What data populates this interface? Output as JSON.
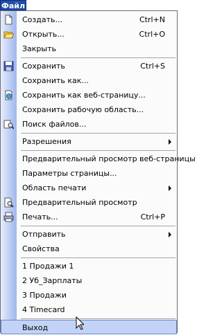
{
  "menubar": {
    "file_label": "Файл"
  },
  "menu": {
    "items": [
      {
        "label": "Создать...",
        "shortcut": "Ctrl+N",
        "icon": "new-document-icon"
      },
      {
        "label": "Открыть...",
        "shortcut": "Ctrl+O",
        "icon": "open-folder-icon"
      },
      {
        "label": "Закрыть",
        "shortcut": ""
      },
      {
        "label": "Сохранить",
        "shortcut": "Ctrl+S",
        "icon": "save-disk-icon"
      },
      {
        "label": "Сохранить как...",
        "shortcut": ""
      },
      {
        "label": "Сохранить как веб-страницу...",
        "shortcut": "",
        "icon": "web-page-icon"
      },
      {
        "label": "Сохранить рабочую область...",
        "shortcut": ""
      },
      {
        "label": "Поиск файлов...",
        "shortcut": "",
        "icon": "file-search-icon"
      },
      {
        "label": "Разрешения",
        "shortcut": "",
        "submenu": true
      },
      {
        "label": "Предварительный просмотр веб-страницы",
        "shortcut": ""
      },
      {
        "label": "Параметры страницы...",
        "shortcut": ""
      },
      {
        "label": "Область печати",
        "shortcut": "",
        "submenu": true
      },
      {
        "label": "Предварительный просмотр",
        "shortcut": "",
        "icon": "print-preview-icon"
      },
      {
        "label": "Печать...",
        "shortcut": "Ctrl+P",
        "icon": "printer-icon"
      },
      {
        "label": "Отправить",
        "shortcut": "",
        "submenu": true
      },
      {
        "label": "Свойства",
        "shortcut": ""
      },
      {
        "label": "1 Продажи 1",
        "shortcut": ""
      },
      {
        "label": "2 Уб_Зарплаты",
        "shortcut": ""
      },
      {
        "label": "3 Продажи",
        "shortcut": ""
      },
      {
        "label": "4 Timecard",
        "shortcut": ""
      },
      {
        "label": "Выход",
        "shortcut": ""
      }
    ]
  }
}
